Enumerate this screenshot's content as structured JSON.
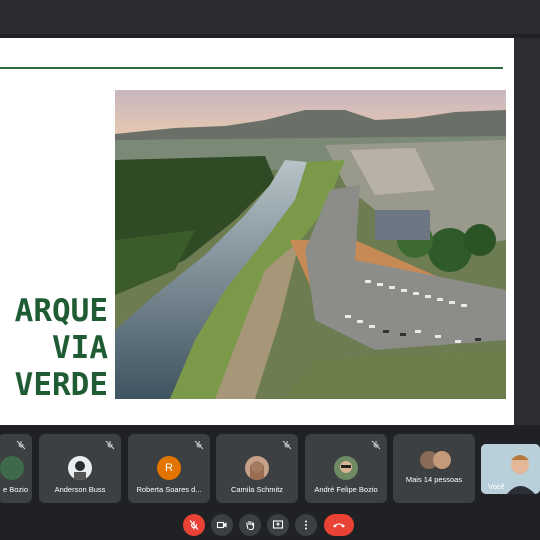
{
  "slide": {
    "title_lines": [
      "ARQUE",
      "VIA",
      "VERDE"
    ],
    "accent_color": "#2e6b3d",
    "title_color": "#1f5c34"
  },
  "participants": [
    {
      "name": "e Bozio",
      "muted": true,
      "avatar": "photo"
    },
    {
      "name": "Anderson Buss",
      "muted": true,
      "avatar": "photo"
    },
    {
      "name": "Roberta Soares d...",
      "muted": true,
      "avatar": "letter",
      "letter": "R"
    },
    {
      "name": "Camila Schmitz",
      "muted": true,
      "avatar": "photo"
    },
    {
      "name": "André Felipe Bozio",
      "muted": true,
      "avatar": "photo"
    },
    {
      "name": "Mais 14 pessoas",
      "muted": false,
      "avatar": "group"
    }
  ],
  "self_view": {
    "label": "Você"
  },
  "controls": {
    "mic": "mic-off-icon",
    "camera": "camera-icon",
    "raise_hand": "hand-icon",
    "present": "present-screen-icon",
    "more": "more-options-icon",
    "leave": "end-call-icon",
    "leave_color": "#ea4335"
  }
}
